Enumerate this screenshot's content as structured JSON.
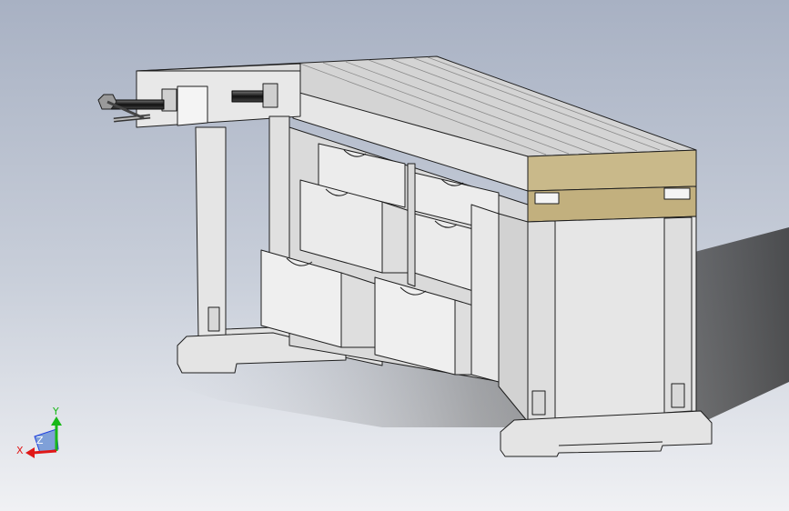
{
  "viewport": {
    "background_top": "#a9b2c4",
    "background_bottom": "#eef0f4",
    "part_fill": "#e3e3e3",
    "part_edge": "#1e1e1e",
    "top_wood": "#c9b98a",
    "shadow": "#3a3a3a"
  },
  "model": {
    "name_icon": "workbench-3d-model",
    "parts": [
      "worktop",
      "front-vise",
      "vise-screw",
      "vise-handle",
      "drawer-cabinet",
      "drawers",
      "side-cabinet",
      "legs",
      "feet",
      "stretcher"
    ]
  },
  "triad": {
    "x_label": "X",
    "y_label": "Y",
    "z_label": "Z",
    "x_color": "#e01818",
    "y_color": "#18b818",
    "z_color": "#2040e0"
  }
}
